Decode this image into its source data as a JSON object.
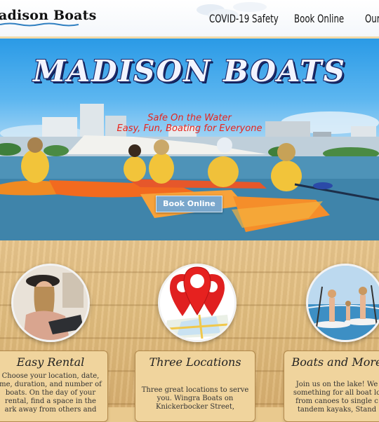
{
  "header": {
    "logo_text": "adison Boats",
    "nav": [
      "COVID-19 Safety",
      "Book Online",
      "Our"
    ]
  },
  "hero": {
    "title": "MADISON BOATS",
    "tagline_1": "Safe On the Water",
    "tagline_2": "Easy, Fun, Boating for Everyone",
    "book_button": "Book Online"
  },
  "features": [
    {
      "title": "Easy Rental",
      "text": [
        "Choose your location, date,",
        "me, duration, and number of",
        "boats. On the day of your",
        "rental, find a space in the",
        "ark away from others and"
      ]
    },
    {
      "title": "Three Locations",
      "text": [
        "Three great locations to serve",
        "you. Wingra Boats on",
        "Knickerbocker Street,"
      ]
    },
    {
      "title": "Boats and More",
      "text": [
        "Join us on the lake! We",
        "something for all boat lo",
        "from canoes to single c",
        "tandem kayaks, Stand"
      ]
    }
  ],
  "colors": {
    "accent_red": "#e8241c",
    "button": "#7aa7cc",
    "wood": "#e2bd7e",
    "pin_red": "#e02020"
  }
}
